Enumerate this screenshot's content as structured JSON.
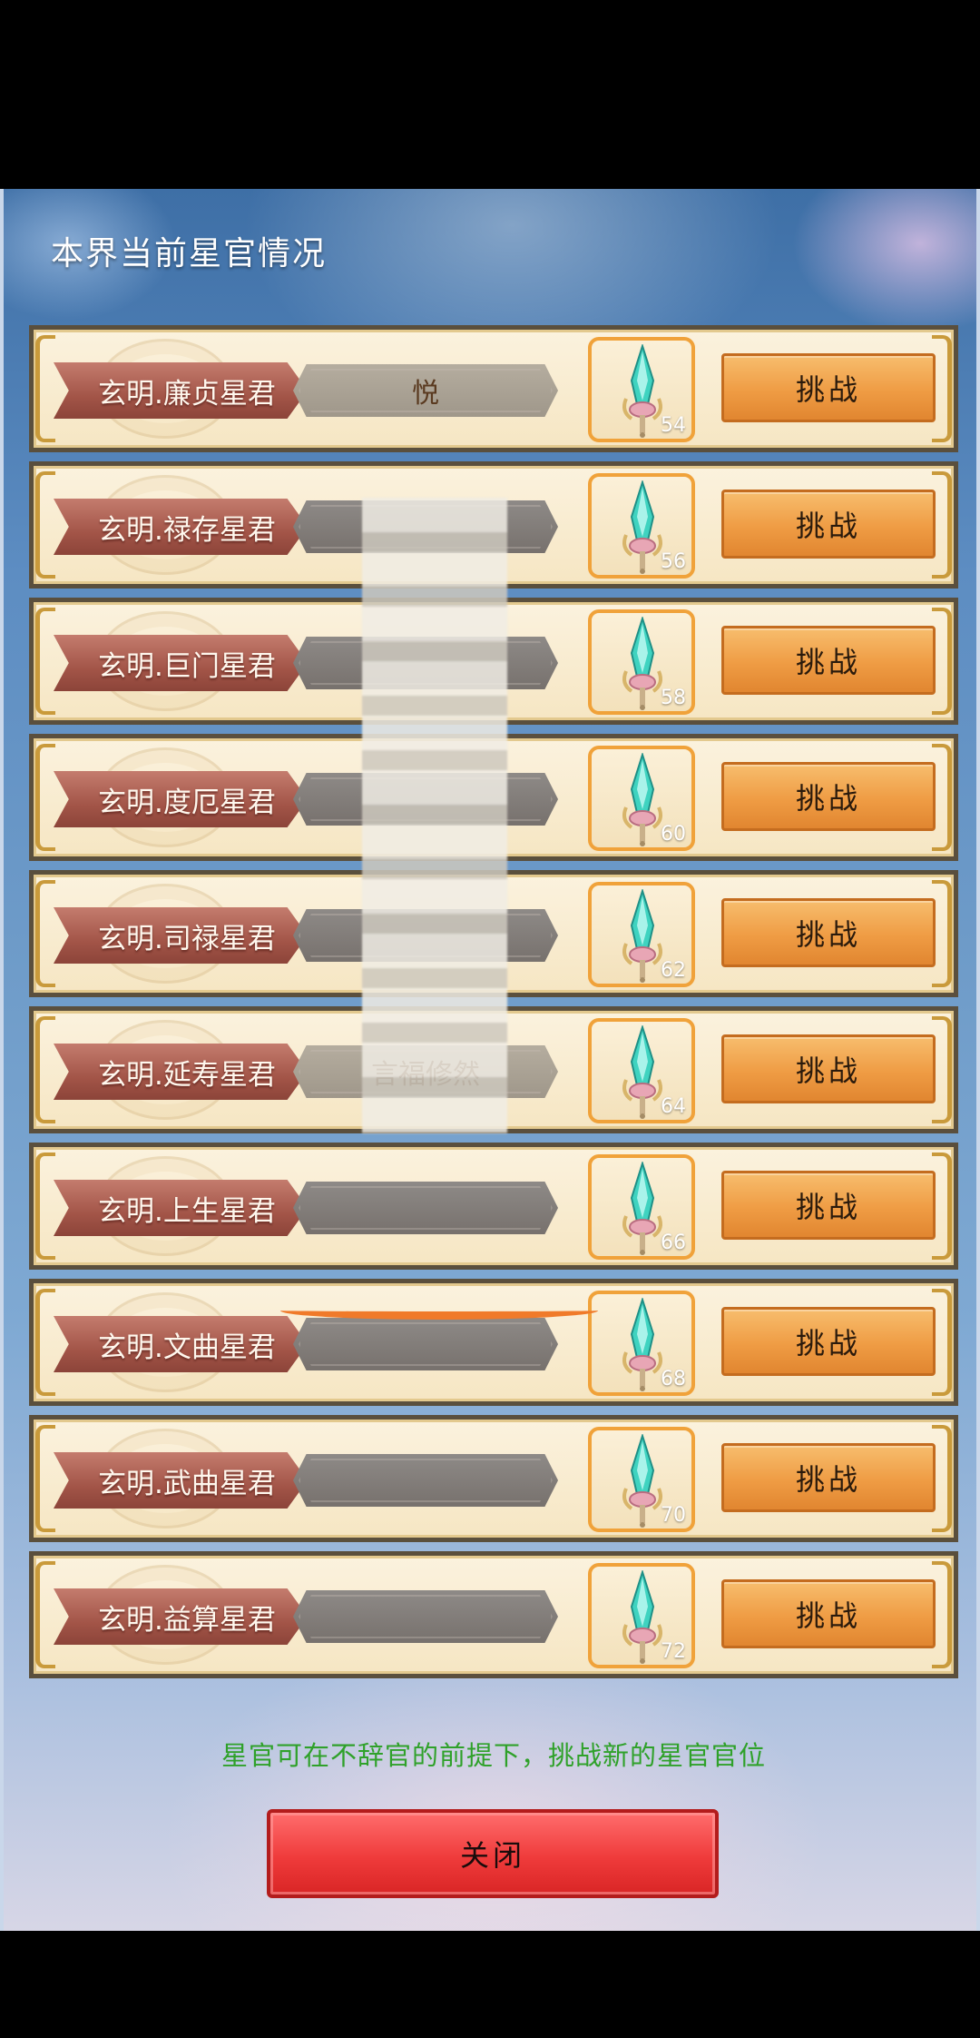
{
  "header": {
    "title": "本界当前星官情况"
  },
  "rows": [
    {
      "title": "玄明.廉贞星君",
      "holder": "悦",
      "level": "54",
      "action": "挑战"
    },
    {
      "title": "玄明.禄存星君",
      "holder": "",
      "level": "56",
      "action": "挑战"
    },
    {
      "title": "玄明.巨门星君",
      "holder": "",
      "level": "58",
      "action": "挑战"
    },
    {
      "title": "玄明.度厄星君",
      "holder": "",
      "level": "60",
      "action": "挑战"
    },
    {
      "title": "玄明.司禄星君",
      "holder": "",
      "level": "62",
      "action": "挑战"
    },
    {
      "title": "玄明.延寿星君",
      "holder": "言福修然",
      "level": "64",
      "action": "挑战"
    },
    {
      "title": "玄明.上生星君",
      "holder": "",
      "level": "66",
      "action": "挑战"
    },
    {
      "title": "玄明.文曲星君",
      "holder": "",
      "level": "68",
      "action": "挑战"
    },
    {
      "title": "玄明.武曲星君",
      "holder": "",
      "level": "70",
      "action": "挑战"
    },
    {
      "title": "玄明.益算星君",
      "holder": "",
      "level": "72",
      "action": "挑战"
    }
  ],
  "footer": {
    "tip": "星官可在不辞官的前提下，挑战新的星官官位",
    "close_label": "关闭"
  },
  "icons": {
    "row_icon": "sword-icon"
  },
  "colors": {
    "challenge": "#ef9c44",
    "close": "#ef3b3b",
    "tip": "#2fa12a"
  }
}
